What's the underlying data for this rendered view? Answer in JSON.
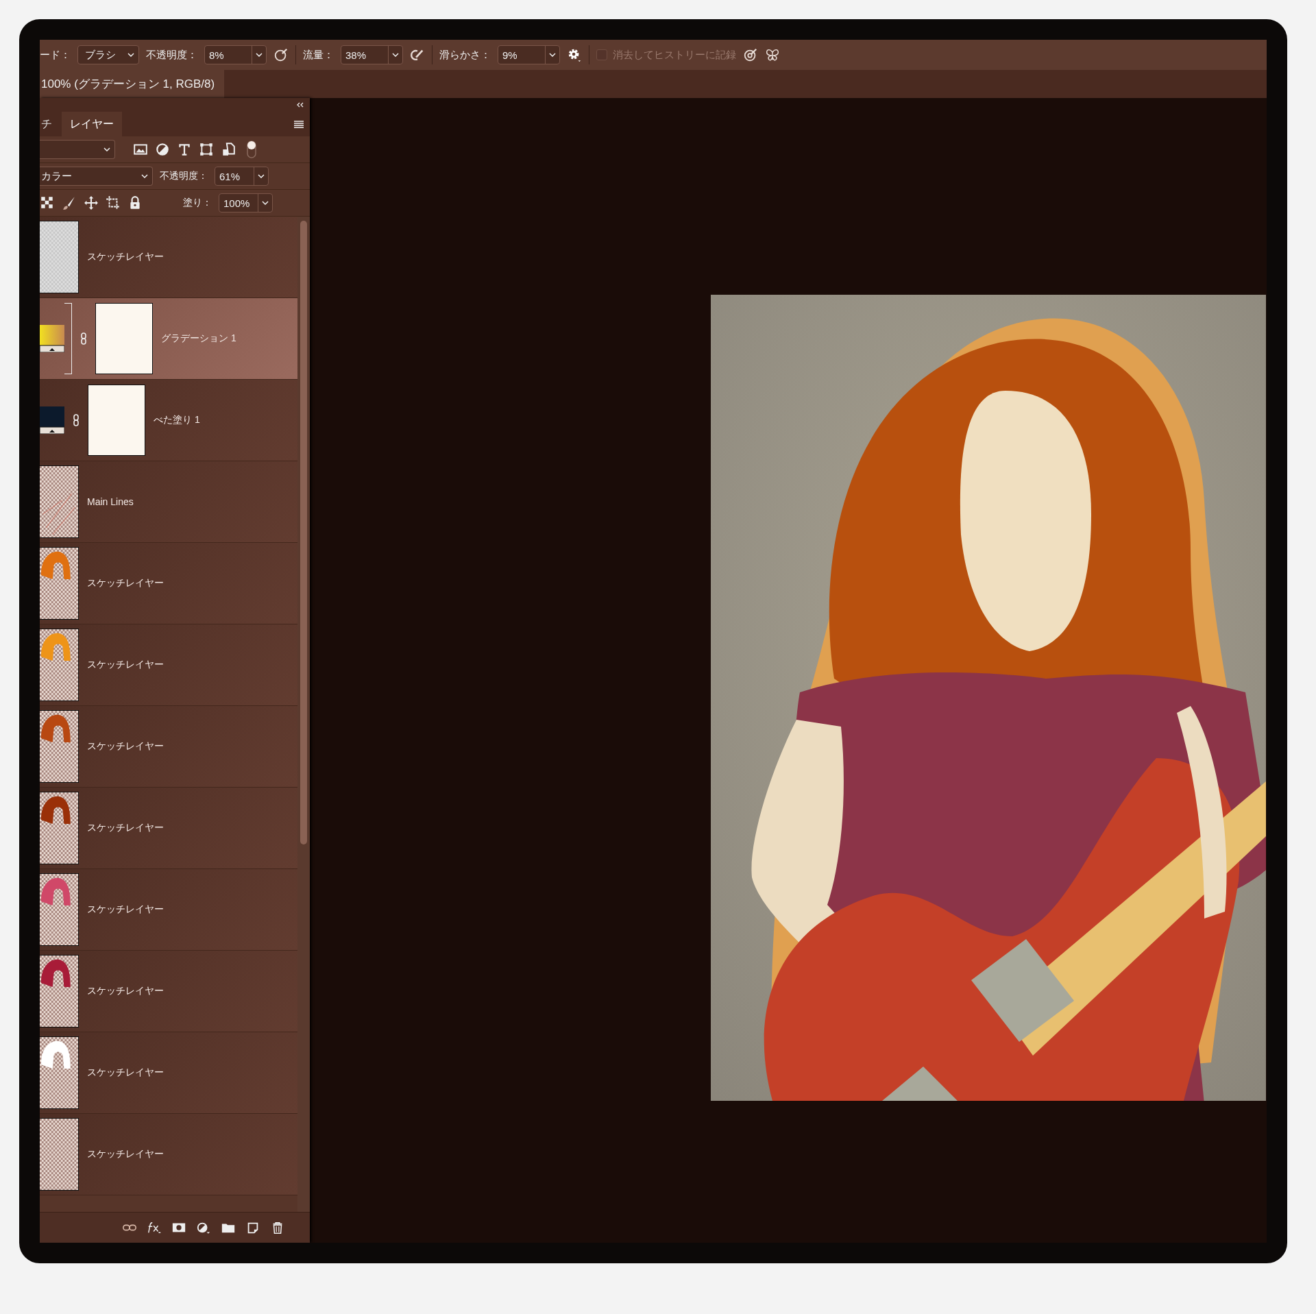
{
  "options_bar": {
    "mode_label": "ード：",
    "mode": "ブラシ",
    "opacity_label": "不透明度：",
    "opacity": "8%",
    "flow_label": "流量：",
    "flow": "38%",
    "smoothing_label": "滑らかさ：",
    "smoothing": "9%",
    "history_checkbox": {
      "label": "消去してヒストリーに記録",
      "checked": false,
      "disabled": true
    }
  },
  "document_tab": {
    "title": "100% (グラデーション 1, RGB/8)"
  },
  "layers_panel": {
    "tabs": [
      {
        "label": "チ",
        "selected": false
      },
      {
        "label": "レイヤー",
        "selected": true
      }
    ],
    "blend_mode": "カラー",
    "opacity_label": "不透明度：",
    "opacity": "61%",
    "fill_label": "塗り：",
    "fill": "100%",
    "layers": [
      {
        "name": "スケッチレイヤー",
        "kind": "pixel",
        "selected": false
      },
      {
        "name": "グラデーション 1",
        "kind": "gradient",
        "selected": true
      },
      {
        "name": "べた塗り 1",
        "kind": "solid",
        "selected": false
      },
      {
        "name": "Main Lines",
        "kind": "lines",
        "selected": false
      },
      {
        "name": "スケッチレイヤー",
        "kind": "pixel",
        "selected": false,
        "color": "#e07010"
      },
      {
        "name": "スケッチレイヤー",
        "kind": "pixel",
        "selected": false,
        "color": "#ee9418"
      },
      {
        "name": "スケッチレイヤー",
        "kind": "pixel",
        "selected": false,
        "color": "#b84812"
      },
      {
        "name": "スケッチレイヤー",
        "kind": "pixel",
        "selected": false,
        "color": "#9a3008"
      },
      {
        "name": "スケッチレイヤー",
        "kind": "pixel",
        "selected": false,
        "color": "#d04868"
      },
      {
        "name": "スケッチレイヤー",
        "kind": "pixel",
        "selected": false,
        "color": "#a81c38"
      },
      {
        "name": "スケッチレイヤー",
        "kind": "pixel",
        "selected": false,
        "color": "#ffffff"
      },
      {
        "name": "スケッチレイヤー",
        "kind": "pixel",
        "selected": false
      }
    ]
  }
}
